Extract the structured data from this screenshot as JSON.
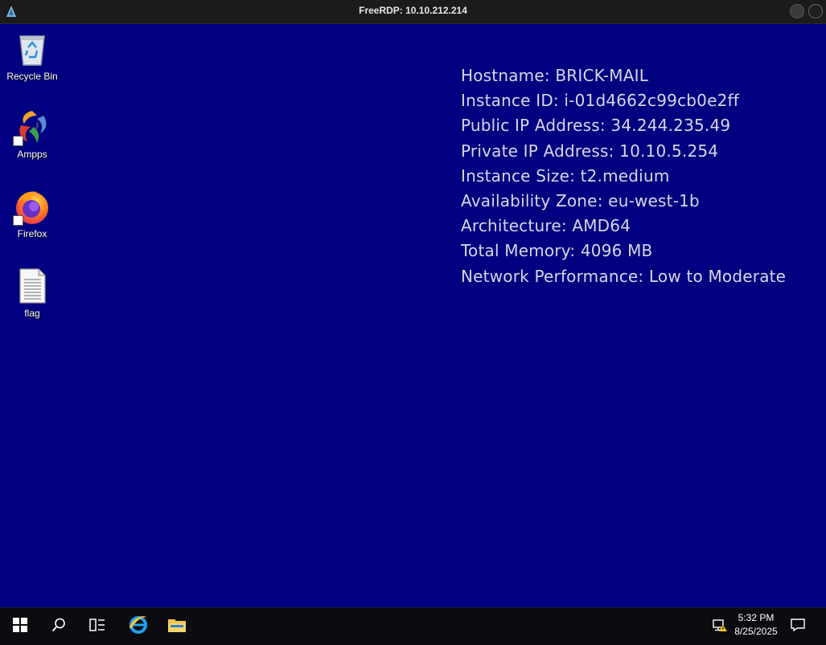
{
  "window": {
    "title": "FreeRDP: 10.10.212.214"
  },
  "desktop_icons": [
    {
      "label": "Recycle Bin",
      "icon": "recycle-bin-icon"
    },
    {
      "label": "Ampps",
      "icon": "ampps-icon"
    },
    {
      "label": "Firefox",
      "icon": "firefox-icon"
    },
    {
      "label": "flag",
      "icon": "text-file-icon"
    }
  ],
  "sysinfo": [
    "Hostname: BRICK-MAIL",
    "Instance ID: i-01d4662c99cb0e2ff",
    "Public IP Address: 34.244.235.49",
    "Private IP Address: 10.10.5.254",
    "Instance Size: t2.medium",
    "Availability Zone: eu-west-1b",
    "Architecture: AMD64",
    "Total Memory: 4096 MB",
    "Network Performance: Low to Moderate"
  ],
  "taskbar": {
    "time": "5:32 PM",
    "date": "8/25/2025"
  },
  "colors": {
    "desktop_background": "#000080",
    "taskbar": "#0c0c10",
    "titlebar": "#1b1b1b"
  }
}
